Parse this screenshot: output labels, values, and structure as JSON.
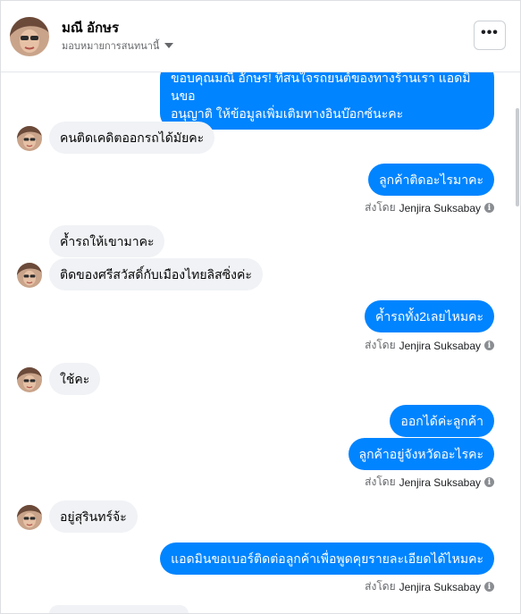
{
  "header": {
    "contact_name": "มณี อักษร",
    "assign_label": "มอบหมายการสนทนานี้",
    "more_label": "•••"
  },
  "messages": [
    {
      "dir": "out",
      "text": "ขอบคุณมณี อักษร! ที่สนใจรถยนต์ของทางร้านเรา แอดมินขอ\nอนุญาติ ให้ข้อมูลเพิ่มเติมทางอินบ๊อกซ์นะคะ"
    },
    {
      "dir": "in",
      "text": "คนติดเคดิตออกรถได้มัยคะ"
    },
    {
      "dir": "out",
      "text": "ลูกค้าติดอะไรมาคะ"
    },
    {
      "dir": "in",
      "text": "ค้ำรถให้เขามาคะ"
    },
    {
      "dir": "in",
      "text": "ติดของศรีสวัสดิ์กับเมืองไทยลิสซิ่งค่ะ"
    },
    {
      "dir": "out",
      "text": "ค้ำรถทั้ง2เลยไหมคะ"
    },
    {
      "dir": "in",
      "text": "ใช้คะ"
    },
    {
      "dir": "out",
      "text": "ออกได้ค่ะลูกค้า"
    },
    {
      "dir": "out",
      "text": "ลูกค้าอยู่จังหวัดอะไรคะ"
    },
    {
      "dir": "in",
      "text": "อยู่สุรินทร์จ้ะ"
    },
    {
      "dir": "out",
      "text": "แอดมินขอเบอร์ติดต่อลูกค้าเพื่อพูดคุยรายละเอียดได้ไหมคะ"
    }
  ],
  "sent_by": {
    "prefix": "ส่งโดย",
    "agent": "Jenjira Suksabay",
    "info_icon": "i"
  }
}
